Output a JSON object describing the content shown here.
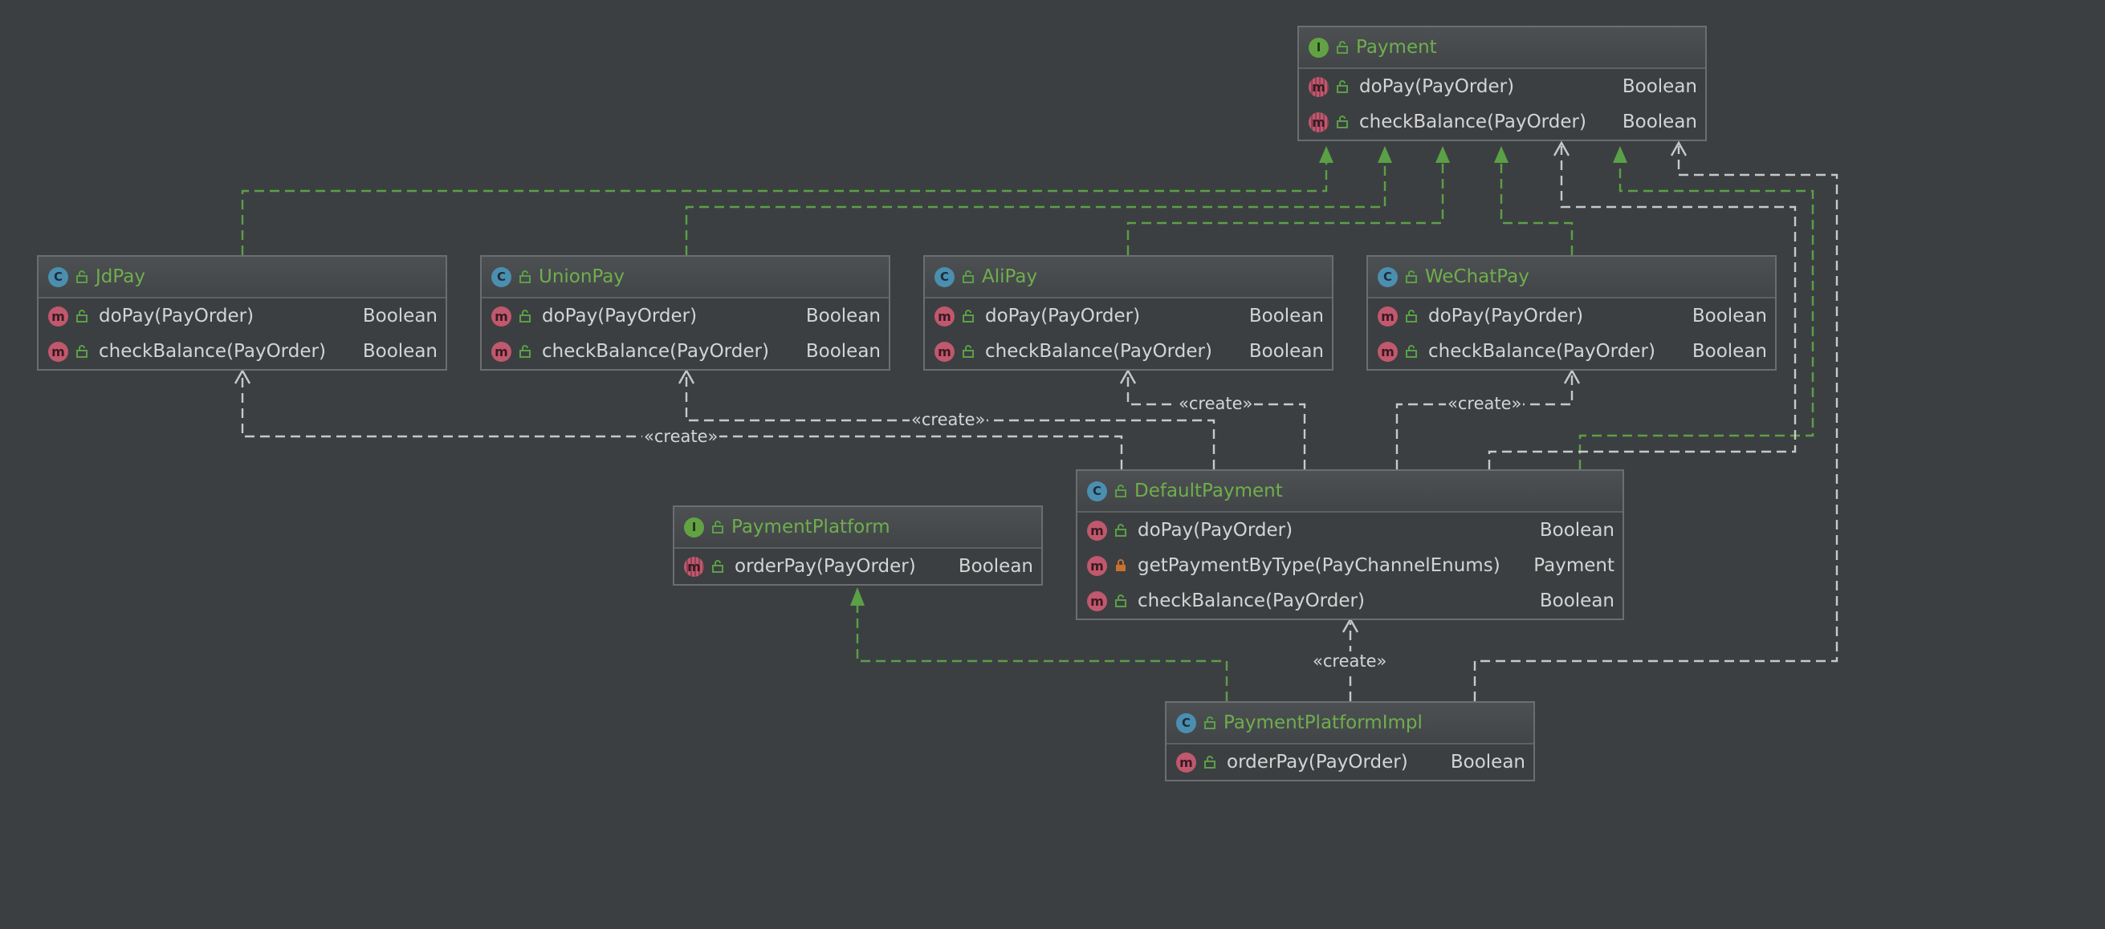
{
  "colors": {
    "background": "#3c3f41",
    "title": "#6fae4d",
    "realization_edge": "#5aa047",
    "dependency_edge": "#c8c8c8",
    "class_badge": "#4b8fb0",
    "interface_badge": "#62a244",
    "method_badge": "#c0586e"
  },
  "nodes": {
    "payment": {
      "name": "Payment",
      "kind": "I",
      "kind_icon": "interface-icon",
      "members": [
        {
          "name": "doPay(PayOrder)",
          "type": "Boolean",
          "icon": "m"
        },
        {
          "name": "checkBalance(PayOrder)",
          "type": "Boolean",
          "icon": "m"
        }
      ]
    },
    "jdpay": {
      "name": "JdPay",
      "kind": "C",
      "kind_icon": "class-icon",
      "members": [
        {
          "name": "doPay(PayOrder)",
          "type": "Boolean",
          "icon": "m"
        },
        {
          "name": "checkBalance(PayOrder)",
          "type": "Boolean",
          "icon": "m"
        }
      ]
    },
    "unionpay": {
      "name": "UnionPay",
      "kind": "C",
      "kind_icon": "class-icon",
      "members": [
        {
          "name": "doPay(PayOrder)",
          "type": "Boolean",
          "icon": "m"
        },
        {
          "name": "checkBalance(PayOrder)",
          "type": "Boolean",
          "icon": "m"
        }
      ]
    },
    "alipay": {
      "name": "AliPay",
      "kind": "C",
      "kind_icon": "class-icon",
      "members": [
        {
          "name": "doPay(PayOrder)",
          "type": "Boolean",
          "icon": "m"
        },
        {
          "name": "checkBalance(PayOrder)",
          "type": "Boolean",
          "icon": "m"
        }
      ]
    },
    "wechatpay": {
      "name": "WeChatPay",
      "kind": "C",
      "kind_icon": "class-icon",
      "members": [
        {
          "name": "doPay(PayOrder)",
          "type": "Boolean",
          "icon": "m"
        },
        {
          "name": "checkBalance(PayOrder)",
          "type": "Boolean",
          "icon": "m"
        }
      ]
    },
    "paymentplatform": {
      "name": "PaymentPlatform",
      "kind": "I",
      "kind_icon": "interface-icon",
      "members": [
        {
          "name": "orderPay(PayOrder)",
          "type": "Boolean",
          "icon": "m"
        }
      ]
    },
    "defaultpayment": {
      "name": "DefaultPayment",
      "kind": "C",
      "kind_icon": "class-icon",
      "members": [
        {
          "name": "doPay(PayOrder)",
          "type": "Boolean",
          "icon": "m"
        },
        {
          "name": "getPaymentByType(PayChannelEnums)",
          "type": "Payment",
          "icon": "m"
        },
        {
          "name": "checkBalance(PayOrder)",
          "type": "Boolean",
          "icon": "m"
        }
      ]
    },
    "paymentplatformimpl": {
      "name": "PaymentPlatformImpl",
      "kind": "C",
      "kind_icon": "class-icon",
      "members": [
        {
          "name": "orderPay(PayOrder)",
          "type": "Boolean",
          "icon": "m"
        }
      ]
    }
  },
  "edge_labels": {
    "create_wechat": "«create»",
    "create_ali": "«create»",
    "create_union": "«create»",
    "create_jd": "«create»",
    "create_default": "«create»"
  }
}
